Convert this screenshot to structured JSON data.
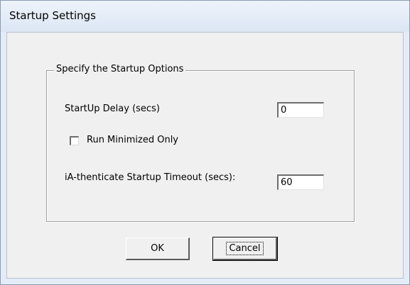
{
  "window": {
    "title": "Startup Settings"
  },
  "group": {
    "legend": "Specify the Startup Options"
  },
  "startup_delay": {
    "label": "StartUp Delay (secs)",
    "value": "0"
  },
  "run_minimized": {
    "label": "Run Minimized Only",
    "checked": false
  },
  "startup_timeout": {
    "label": "iA-thenticate Startup Timeout (secs):",
    "value": "60"
  },
  "buttons": {
    "ok_label": "OK",
    "cancel_label": "Cancel"
  }
}
